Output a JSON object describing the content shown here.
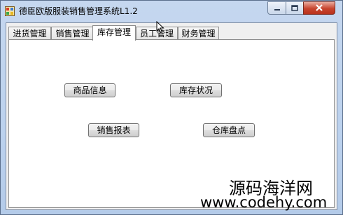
{
  "window": {
    "title": "德臣欧版服装销售管理系统L1.2"
  },
  "tabs": [
    {
      "label": "进货管理",
      "active": false
    },
    {
      "label": "销售管理",
      "active": false
    },
    {
      "label": "库存管理",
      "active": true
    },
    {
      "label": "员工管理",
      "active": false
    },
    {
      "label": "财务管理",
      "active": false
    }
  ],
  "panel": {
    "buttons": {
      "product_info": "商品信息",
      "stock_status": "库存状况",
      "sales_report": "销售报表",
      "inventory_check": "仓库盘点"
    }
  },
  "watermark": {
    "site_name": "源码海洋网",
    "url": "www.codehy.com"
  },
  "colors": {
    "title_bar": "#bcd2ee",
    "close_button": "#c7442e",
    "panel_background": "#ffffff"
  },
  "icons": [
    "app-icon",
    "minimize-icon",
    "maximize-icon",
    "close-icon",
    "cursor-icon"
  ]
}
